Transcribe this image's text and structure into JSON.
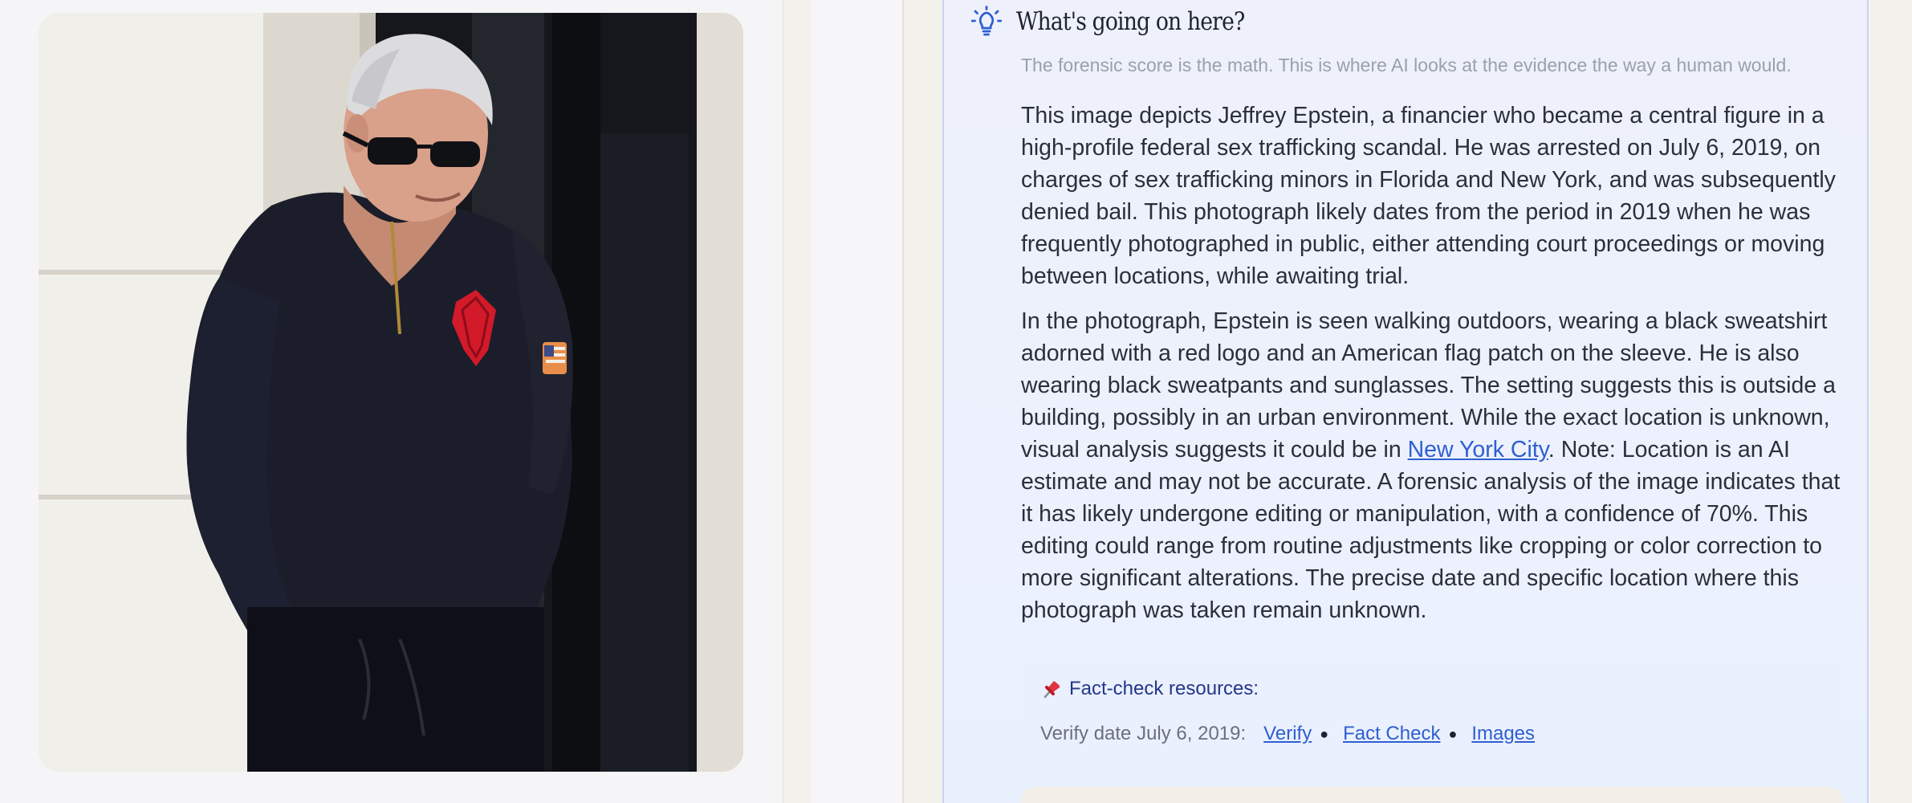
{
  "photo": {
    "subject": "man-walking-photo"
  },
  "analysis": {
    "heading": "What's going on here?",
    "subtitle": "The forensic score is the math. This is where AI looks at the evidence the way a human would.",
    "paragraph1": "This image depicts Jeffrey Epstein, a financier who became a central figure in a high-profile federal sex trafficking scandal. He was arrested on July 6, 2019, on charges of sex trafficking minors in Florida and New York, and was subsequently denied bail. This photograph likely dates from the period in 2019 when he was frequently photographed in public, either attending court proceedings or moving between locations, while awaiting trial.",
    "paragraph2_before": "In the photograph, Epstein is seen walking outdoors, wearing a black sweatshirt adorned with a red logo and an American flag patch on the sleeve. He is also wearing black sweatpants and sunglasses. The setting suggests this is outside a building, possibly in an urban environment. While the exact location is unknown, visual analysis suggests it could be in ",
    "paragraph2_link": "New York City",
    "paragraph2_after": ". Note: Location is an AI estimate and may not be accurate. A forensic analysis of the image indicates that it has likely undergone editing or manipulation, with a confidence of 70%. This editing could range from routine adjustments like cropping or color correction to more significant alterations. The precise date and specific location where this photograph was taken remain unknown."
  },
  "factcheck": {
    "icon": "pushpin-icon",
    "title": "Fact-check resources:",
    "label": "Verify date July 6, 2019:",
    "links": [
      "Verify",
      "Fact Check",
      "Images"
    ]
  },
  "colors": {
    "accent": "#2f5fd0",
    "heading": "#1f2330",
    "panel_border": "#c9d3ef"
  }
}
